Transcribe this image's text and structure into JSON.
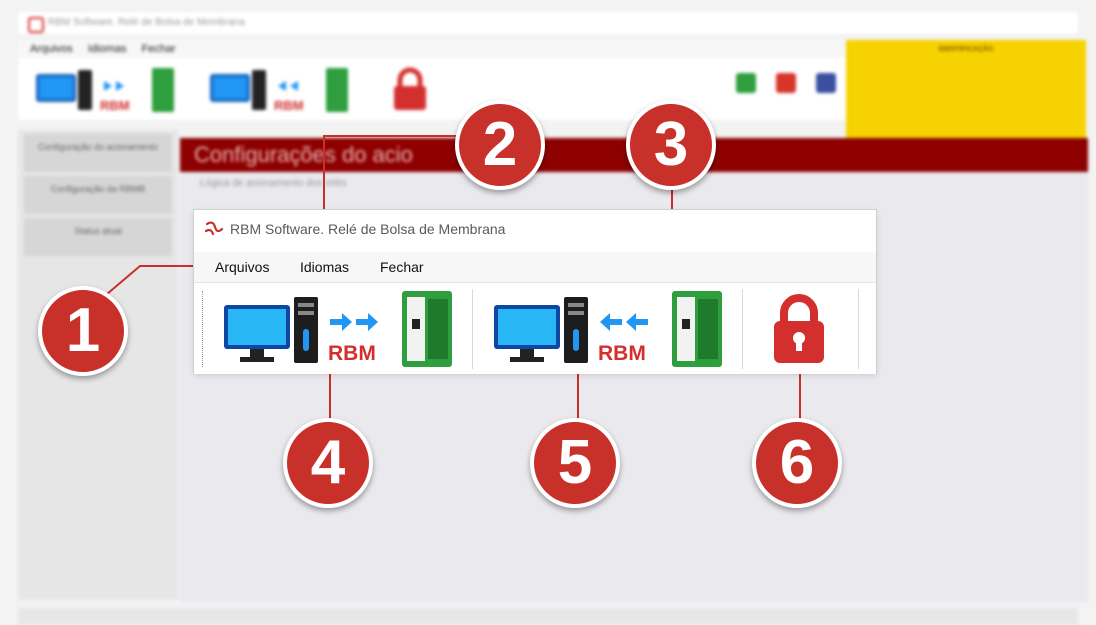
{
  "background": {
    "window_title": "RBM Software. Relé de Bolsa de Membrana",
    "menu": [
      "Arquivos",
      "Idiomas",
      "Fechar"
    ],
    "sidebar": [
      "Configuração do acionamento",
      "Configuração da RBMB",
      "Status atual"
    ],
    "main_header": "Configurações do acio",
    "main_subtitle": "Lógica de acionamento dos relés",
    "id_box_title": "IDENTIFICAÇÃO"
  },
  "window": {
    "title": "RBM Software. Relé de Bolsa de Membrana",
    "menu": {
      "arquivos": "Arquivos",
      "idiomas": "Idiomas",
      "fechar": "Fechar"
    },
    "toolbar": {
      "send_label": "RBM",
      "receive_label": "RBM"
    }
  },
  "callouts": [
    "1",
    "2",
    "3",
    "4",
    "5",
    "6"
  ],
  "colors": {
    "accent_red": "#c8302a",
    "header_red": "#8e0000",
    "arrow_blue": "#2196f3",
    "device_green": "#2e9e3e"
  }
}
